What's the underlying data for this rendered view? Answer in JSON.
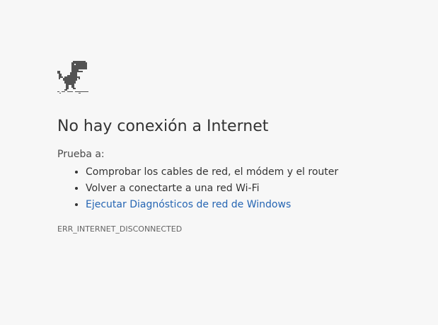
{
  "page": {
    "title": "No hay conexión a Internet",
    "suggestions_label": "Prueba a:",
    "suggestions": [
      "Comprobar los cables de red, el módem y el router",
      "Volver a conectarte a una red Wi-Fi"
    ],
    "diagnostics_link": "Ejecutar Diagnósticos de red de Windows",
    "error_code": "ERR_INTERNET_DISCONNECTED"
  },
  "icons": {
    "offline": "dinosaur-icon"
  },
  "colors": {
    "background": "#f7f7f7",
    "text": "#333333",
    "link": "#2565b3",
    "error_code": "#646464",
    "dino": "#535353"
  }
}
